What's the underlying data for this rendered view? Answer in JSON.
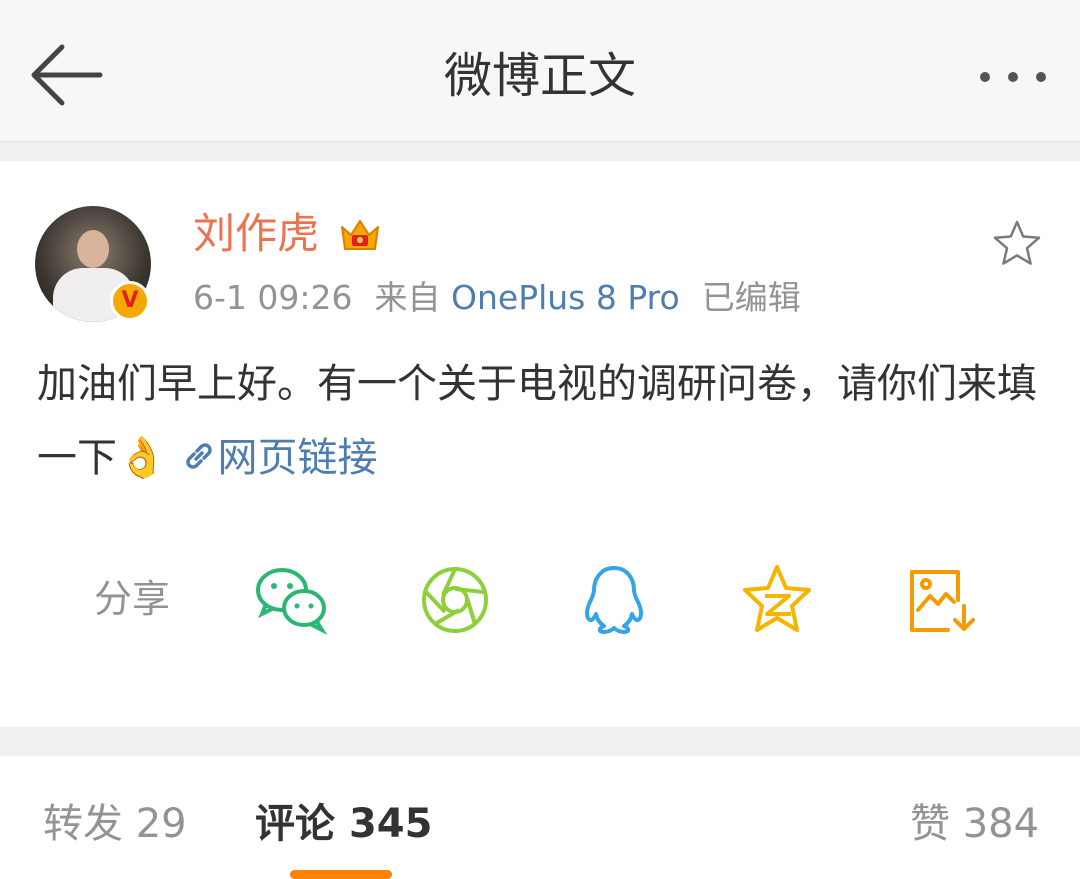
{
  "header": {
    "title": "微博正文",
    "back_icon": "back-arrow-icon",
    "more_icon": "more-dots-icon"
  },
  "post": {
    "author": "刘作虎",
    "badge_text": "V",
    "time": "6-1 09:26",
    "source_prefix": "来自",
    "source": "OnePlus 8 Pro",
    "edited": "已编辑",
    "text": "加油们早上好。有一个关于电视的调研问卷，请你们来填一下",
    "emoji": "👌",
    "link_icon": "link-icon",
    "link_text": "网页链接",
    "favorite_icon": "star-outline-icon"
  },
  "share": {
    "label": "分享",
    "targets": [
      {
        "icon": "wechat-icon",
        "color": "#2bb673"
      },
      {
        "icon": "moments-icon",
        "color": "#8fcf3c"
      },
      {
        "icon": "qq-icon",
        "color": "#35a4e6"
      },
      {
        "icon": "qzone-icon",
        "color": "#f5b400"
      },
      {
        "icon": "save-image-icon",
        "color": "#f59a00"
      }
    ]
  },
  "tabs": {
    "repost": {
      "label": "转发",
      "count": "29"
    },
    "comments": {
      "label": "评论",
      "count": "345"
    },
    "likes": {
      "label": "赞",
      "count": "384"
    },
    "active": "comments"
  },
  "colors": {
    "accent": "#ff8200",
    "username": "#eb7350",
    "link": "#507daf",
    "secondary_text": "#939393"
  }
}
